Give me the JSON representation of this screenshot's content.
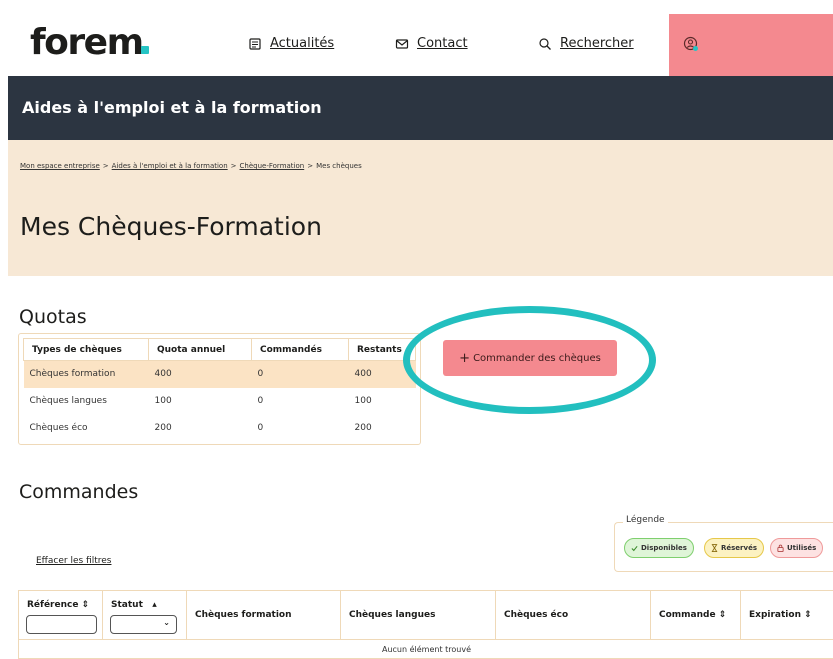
{
  "header": {
    "logo_text": "forem",
    "nav": [
      {
        "label": "Actualités",
        "icon": "newspaper-icon"
      },
      {
        "label": "Contact",
        "icon": "mail-icon"
      },
      {
        "label": "Rechercher",
        "icon": "search-icon"
      }
    ],
    "account_icon": "user-account-icon"
  },
  "band": {
    "label": "Aides à l'emploi et à la formation"
  },
  "breadcrumb": {
    "items": [
      "Mon espace entreprise",
      "Aides à l'emploi et à la formation",
      "Chèque-Formation"
    ],
    "current": "Mes chèques",
    "separator": ">"
  },
  "page": {
    "title": "Mes Chèques-Formation"
  },
  "quotas": {
    "title": "Quotas",
    "columns": [
      "Types de chèques",
      "Quota annuel",
      "Commandés",
      "Restants"
    ],
    "rows": [
      [
        "Chèques formation",
        "400",
        "0",
        "400"
      ],
      [
        "Chèques langues",
        "100",
        "0",
        "100"
      ],
      [
        "Chèques éco",
        "200",
        "0",
        "200"
      ]
    ],
    "highlighted_row": 0
  },
  "order_button": {
    "icon": "+",
    "label": "Commander des chèques"
  },
  "commandes": {
    "title": "Commandes",
    "clear_filters": "Effacer les filtres",
    "legend": {
      "title": "Légende",
      "items": [
        {
          "label": "Disponibles",
          "icon": "check-icon"
        },
        {
          "label": "Réservés",
          "icon": "hourglass-icon"
        },
        {
          "label": "Utilisés",
          "icon": "lock-icon"
        }
      ]
    },
    "columns": [
      {
        "label": "Référence",
        "sort": "⇕"
      },
      {
        "label": "Statut",
        "sort": "▴"
      },
      {
        "label": "Chèques formation"
      },
      {
        "label": "Chèques langues"
      },
      {
        "label": "Chèques éco"
      },
      {
        "label": "Commande",
        "sort": "⇕"
      },
      {
        "label": "Expiration",
        "sort": "⇕"
      }
    ],
    "status_caret": "⌄",
    "empty_text": "Aucun élément trouvé"
  },
  "colors": {
    "accent_pink": "#f4898f",
    "dark_band": "#2c3541",
    "hero_beige": "#f7e8d5",
    "highlight_ring": "#22bfbf"
  }
}
